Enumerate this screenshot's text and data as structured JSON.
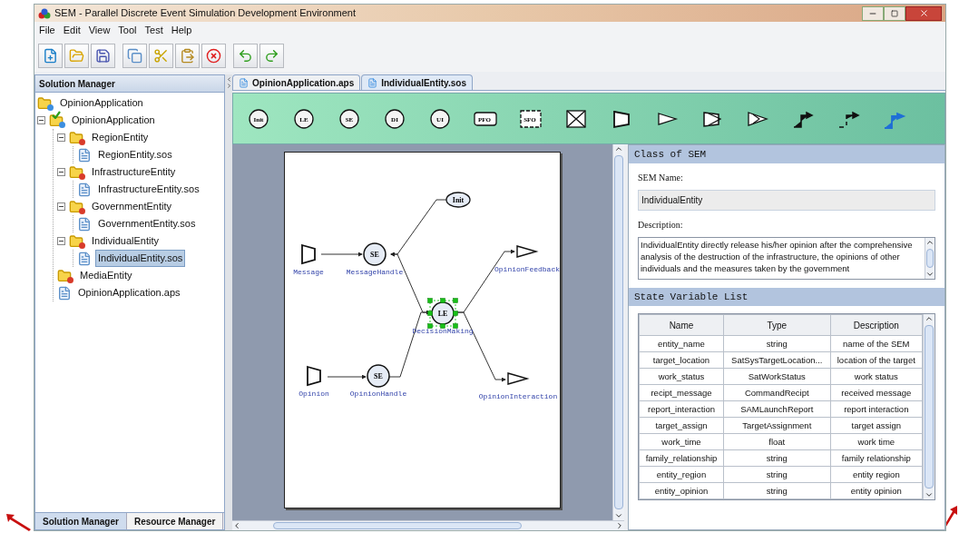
{
  "window": {
    "title": "SEM - Parallel Discrete Event Simulation Development Environment"
  },
  "menu": [
    "File",
    "Edit",
    "View",
    "Tool",
    "Test",
    "Help"
  ],
  "solution_manager": {
    "title": "Solution Manager",
    "tree": [
      {
        "label": "OpinionApplication",
        "kind": "app",
        "selected": false
      },
      {
        "label": "OpinionApplication",
        "kind": "app-checked",
        "selected": false,
        "expanded": true,
        "children": [
          {
            "label": "RegionEntity",
            "kind": "entity",
            "selected": false,
            "expanded": true,
            "children": [
              {
                "label": "RegionEntity.sos",
                "kind": "file",
                "selected": false
              }
            ]
          },
          {
            "label": "InfrastructureEntity",
            "kind": "entity",
            "selected": false,
            "expanded": true,
            "children": [
              {
                "label": "InfrastructureEntity.sos",
                "kind": "file",
                "selected": false
              }
            ]
          },
          {
            "label": "GovernmentEntity",
            "kind": "entity",
            "selected": false,
            "expanded": true,
            "children": [
              {
                "label": "GovernmentEntity.sos",
                "kind": "file",
                "selected": false
              }
            ]
          },
          {
            "label": "IndividualEntity",
            "kind": "entity",
            "selected": false,
            "expanded": true,
            "children": [
              {
                "label": "IndividualEntity.sos",
                "kind": "file",
                "selected": true
              }
            ]
          },
          {
            "label": "MediaEntity",
            "kind": "entity",
            "selected": false
          },
          {
            "label": "OpinionApplication.aps",
            "kind": "file",
            "selected": false
          }
        ]
      }
    ],
    "tabs": [
      {
        "label": "Solution Manager",
        "selected": true
      },
      {
        "label": "Resource Manager",
        "selected": false
      }
    ]
  },
  "editor_tabs": [
    {
      "label": "OpinionApplication.aps",
      "selected": false
    },
    {
      "label": "IndividualEntity.sos",
      "selected": true
    }
  ],
  "palette": [
    {
      "kind": "circle",
      "symbol": "Init"
    },
    {
      "kind": "circle",
      "symbol": "LE"
    },
    {
      "kind": "circle",
      "symbol": "SE"
    },
    {
      "kind": "circle",
      "symbol": "DI"
    },
    {
      "kind": "circle",
      "symbol": "UI"
    },
    {
      "kind": "box",
      "symbol": "PFO"
    },
    {
      "kind": "dashed-box",
      "symbol": "SFO"
    },
    {
      "kind": "crossed-box"
    },
    {
      "kind": "input"
    },
    {
      "kind": "output"
    },
    {
      "kind": "double-input"
    },
    {
      "kind": "double-output"
    },
    {
      "kind": "link"
    },
    {
      "kind": "dashed-link"
    },
    {
      "kind": "blue-link"
    }
  ],
  "diagram": {
    "nodes": [
      {
        "kind": "ellipse",
        "symbol": "Init",
        "selected": false
      },
      {
        "kind": "input",
        "label": "Message",
        "selected": false
      },
      {
        "kind": "circle",
        "symbol": "SE",
        "label": "MessageHandle",
        "selected": false
      },
      {
        "kind": "circle",
        "symbol": "LE",
        "label": "DecisionMaking",
        "selected": true
      },
      {
        "kind": "input",
        "label": "Opinion",
        "selected": false
      },
      {
        "kind": "circle",
        "symbol": "SE",
        "label": "OpinionHandle",
        "selected": false
      },
      {
        "kind": "output",
        "label": "OpinionFeedback",
        "selected": false
      },
      {
        "kind": "output",
        "label": "OpinionInteraction",
        "selected": false
      }
    ]
  },
  "properties": {
    "title": "Class of SEM",
    "name_label": "SEM Name:",
    "name_value": "IndividualEntity",
    "description_label": "Description:",
    "description": "IndividualEntity directly release his/her opinion after the comprehensive analysis of the destruction of the infrastructure, the opinions of other individuals and the measures taken by the government",
    "list_title": "State Variable List",
    "table": {
      "columns": [
        "Name",
        "Type",
        "Description"
      ],
      "rows": [
        [
          "entity_name",
          "string",
          "name of the SEM"
        ],
        [
          "target_location",
          "SatSysTargetLocation...",
          "location of the target"
        ],
        [
          "work_status",
          "SatWorkStatus",
          "work status"
        ],
        [
          "recipt_message",
          "CommandRecipt",
          "received message"
        ],
        [
          "report_interaction",
          "SAMLaunchReport",
          "report interaction"
        ],
        [
          "target_assign",
          "TargetAssignment",
          "target assign"
        ],
        [
          "work_time",
          "float",
          "work time"
        ],
        [
          "family_relationship",
          "string",
          "family relationship"
        ],
        [
          "entity_region",
          "string",
          "entity region"
        ],
        [
          "entity_opinion",
          "string",
          "entity opinion"
        ]
      ]
    }
  }
}
